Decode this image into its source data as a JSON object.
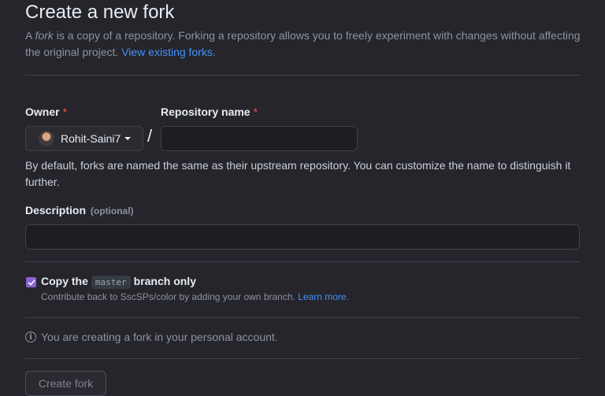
{
  "page": {
    "title": "Create a new fork",
    "intro_prefix": "A ",
    "intro_em": "fork",
    "intro_body": " is a copy of a repository. Forking a repository allows you to freely experiment with changes without affecting the original project. ",
    "intro_link": "View existing forks."
  },
  "owner": {
    "label": "Owner",
    "required_mark": "*",
    "value": "Rohit-Saini7",
    "avatar_icon": "user-avatar"
  },
  "separator": "/",
  "repository": {
    "label": "Repository name",
    "required_mark": "*",
    "value": "",
    "hint": "By default, forks are named the same as their upstream repository. You can customize the name to distinguish it further."
  },
  "description": {
    "label": "Description",
    "optional": "(optional)",
    "value": ""
  },
  "copy_branch": {
    "checked": true,
    "prefix": "Copy the",
    "branch": "master",
    "suffix": "branch only",
    "hint_text": "Contribute back to SscSPs/color by adding your own branch. ",
    "hint_link": "Learn more."
  },
  "info": {
    "icon": "info-icon",
    "text": "You are creating a fork in your personal account."
  },
  "actions": {
    "create_label": "Create fork"
  },
  "colors": {
    "background": "#25252b",
    "link": "#4493f8",
    "required": "#f85149",
    "checkbox": "#8a63d2"
  }
}
